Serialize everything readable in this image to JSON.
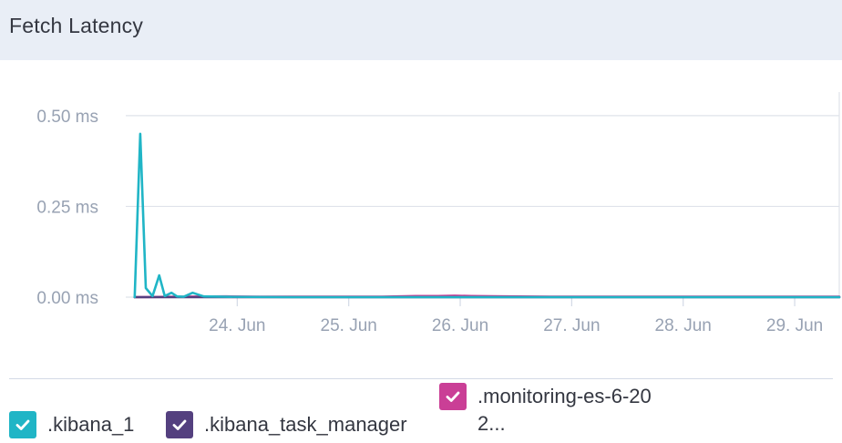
{
  "panel": {
    "title": "Fetch Latency"
  },
  "chart_data": {
    "type": "line",
    "title": "Fetch Latency",
    "ylim": [
      0,
      0.55
    ],
    "y_ticks": [
      {
        "value": 0,
        "label": "0.00 ms"
      },
      {
        "value": 0.25,
        "label": "0.25 ms"
      },
      {
        "value": 0.5,
        "label": "0.50 ms"
      }
    ],
    "xlim": [
      23.0,
      29.4
    ],
    "x_ticks": [
      {
        "value": 24,
        "label": "24. Jun"
      },
      {
        "value": 25,
        "label": "25. Jun"
      },
      {
        "value": 26,
        "label": "26. Jun"
      },
      {
        "value": 27,
        "label": "27. Jun"
      },
      {
        "value": 28,
        "label": "28. Jun"
      },
      {
        "value": 29,
        "label": "29. Jun"
      }
    ],
    "grid": true,
    "legend_position": "bottom",
    "series": [
      {
        "name": ".kibana_1",
        "color": "#20b5c6",
        "x": [
          23.08,
          23.13,
          23.18,
          23.24,
          23.3,
          23.35,
          23.41,
          23.46,
          23.52,
          23.6,
          23.7,
          23.9,
          24.5,
          25.5,
          26.5,
          27.5,
          28.5,
          29.4
        ],
        "y": [
          0.0,
          0.45,
          0.025,
          0.003,
          0.06,
          0.003,
          0.012,
          0.002,
          0.001,
          0.012,
          0.002,
          0.001,
          0.0,
          0.0,
          0.0,
          0.0,
          0.0,
          0.0
        ]
      },
      {
        "name": ".kibana_task_manager",
        "color": "#54407f",
        "x": [
          23.08,
          23.5,
          24.0,
          25.0,
          26.0,
          27.0,
          28.0,
          29.0,
          29.4
        ],
        "y": [
          0.0,
          0.0,
          0.0,
          0.0,
          0.0,
          0.0,
          0.0,
          0.0,
          0.0
        ]
      },
      {
        "name": ".monitoring-es-6-202...",
        "color": "#ca3f96",
        "x": [
          23.08,
          23.5,
          23.9,
          24.2,
          24.5,
          24.9,
          25.3,
          25.6,
          25.8,
          25.95,
          26.1,
          26.4,
          26.8,
          27.2,
          27.6,
          28.0,
          28.5,
          29.0,
          29.4
        ],
        "y": [
          0.0,
          0.001,
          0.002,
          0.001,
          0.001,
          0.001,
          0.001,
          0.003,
          0.003,
          0.004,
          0.003,
          0.002,
          0.001,
          0.001,
          0.001,
          0.001,
          0.001,
          0.001,
          0.001
        ]
      }
    ]
  },
  "legend": [
    {
      "label": ".kibana_1",
      "color": "#20b5c6",
      "checked": true
    },
    {
      "label": ".kibana_task_manager",
      "color": "#54407f",
      "checked": true
    },
    {
      "label": ".monitoring-es-6-202...",
      "color": "#ca3f96",
      "checked": true
    }
  ]
}
